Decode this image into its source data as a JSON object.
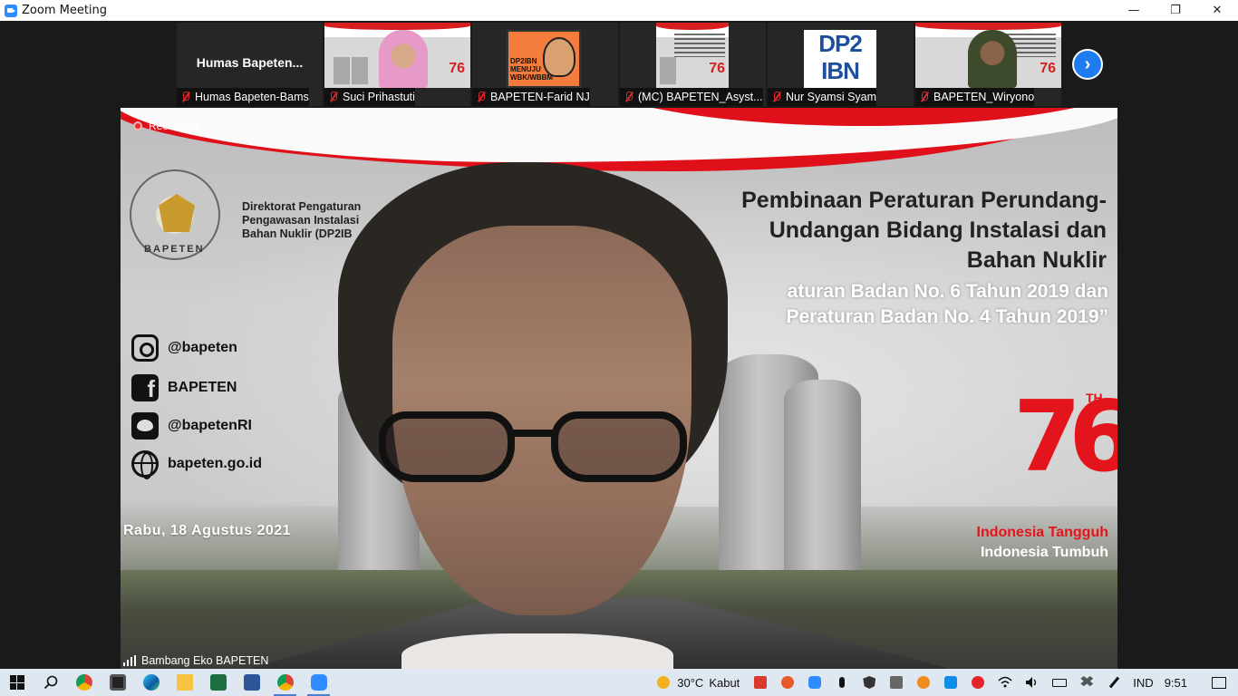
{
  "window": {
    "title": "Zoom Meeting",
    "minimize": "—",
    "restore": "❐",
    "close": "✕"
  },
  "thumbnails": [
    {
      "label": "Humas Bapeten-Bams",
      "display_name": "Humas  Bapeten...",
      "type": "name"
    },
    {
      "label": "Suci Prihastuti",
      "type": "slide-person"
    },
    {
      "label": "BAPETEN-Farid NJ",
      "type": "poster",
      "poster_text": "DP2IBN MENUJU WBK/WBBM"
    },
    {
      "label": "(MC) BAPETEN_Asyst...",
      "type": "slide"
    },
    {
      "label": "Nur Syamsi Syam",
      "type": "dp2ibn",
      "logo_line1": "DP2",
      "logo_line2": "IBN"
    },
    {
      "label": "BAPETEN_Wiryono",
      "type": "slide-person"
    }
  ],
  "next_button": "›",
  "speaker": {
    "recording_label": "Recording",
    "name": "Bambang Eko BAPETEN",
    "slide": {
      "logo_text": "BAPETEN",
      "org_lines": [
        "Direktorat Pengaturan",
        "Pengawasan Instalasi",
        "Bahan Nuklir (DP2IB"
      ],
      "social": [
        {
          "icon": "instagram-icon",
          "text": "@bapeten"
        },
        {
          "icon": "facebook-icon",
          "text": "BAPETEN"
        },
        {
          "icon": "twitter-icon",
          "text": "@bapetenRI"
        },
        {
          "icon": "globe-icon",
          "text": "bapeten.go.id"
        }
      ],
      "date": "Rabu, 18 Agustus 2021",
      "headline": [
        "Pembinaan Peraturan Perundang-",
        "Undangan Bidang Instalasi dan",
        "Bahan Nuklir"
      ],
      "subline": [
        "aturan Badan No. 6 Tahun 2019 dan",
        "Peraturan Badan No. 4 Tahun 2019”"
      ],
      "logo76_number": "76",
      "logo76_suffix": "TH",
      "tagline1": "Indonesia Tangguh",
      "tagline2": "Indonesia Tumbuh"
    }
  },
  "taskbar": {
    "weather_temp": "30°C",
    "weather_text": "Kabut",
    "language": "IND",
    "time": "9:51",
    "accent": "#dfe7f0"
  }
}
